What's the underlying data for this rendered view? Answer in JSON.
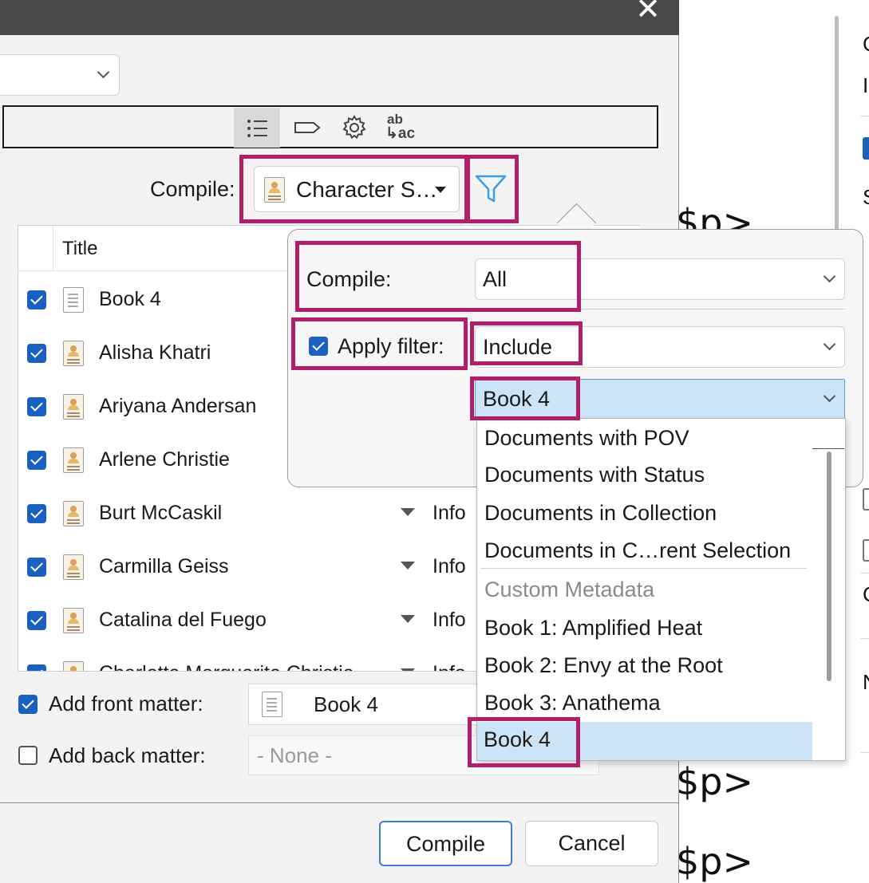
{
  "background": {
    "code_fragments": [
      "$p>",
      "$p>",
      "$p>"
    ],
    "side_letters": [
      "C",
      "I",
      "S",
      "C",
      "N"
    ]
  },
  "dialog": {
    "close_glyph": "✕",
    "toolbar": {
      "tabs": [
        {
          "icon": "list-icon",
          "active": true
        },
        {
          "icon": "tag-icon"
        },
        {
          "icon": "gear-icon"
        },
        {
          "icon": "replacements-icon",
          "label_top": "ab",
          "label_bottom": "↳ac"
        }
      ]
    },
    "compile": {
      "label": "Compile:",
      "selected": "Character S…"
    },
    "list": {
      "title_header": "Title",
      "rows": [
        {
          "title": "Book 4",
          "checked": true,
          "icon": "document-icon",
          "info": ""
        },
        {
          "title": "Alisha Khatri",
          "checked": true,
          "icon": "character-icon",
          "info": ""
        },
        {
          "title": "Ariyana Andersan",
          "checked": true,
          "icon": "character-icon",
          "info": ""
        },
        {
          "title": "Arlene Christie",
          "checked": true,
          "icon": "character-icon",
          "info": ""
        },
        {
          "title": "Burt McCaskil",
          "checked": true,
          "icon": "character-icon",
          "info": "Info"
        },
        {
          "title": "Carmilla Geiss",
          "checked": true,
          "icon": "character-icon",
          "info": "Info"
        },
        {
          "title": "Catalina del Fuego",
          "checked": true,
          "icon": "character-icon",
          "info": "Info"
        },
        {
          "title": "Charlotte Marguerite Christie",
          "checked": true,
          "icon": "character-icon",
          "info": "Info"
        }
      ]
    },
    "front_matter": {
      "label": "Add front matter:",
      "checked": true,
      "value": "Book 4"
    },
    "back_matter": {
      "label": "Add back matter:",
      "checked": false,
      "value": "- None -"
    },
    "buttons": {
      "compile": "Compile",
      "cancel": "Cancel"
    }
  },
  "filter_popover": {
    "compile_label": "Compile:",
    "compile_value": "All",
    "apply_filter_label": "Apply filter:",
    "apply_filter_checked": true,
    "mode_value": "Include",
    "target_value": "Book 4",
    "options": [
      "Documents with POV",
      "Documents with Status",
      "Documents in Collection",
      "Documents in C…rent Selection",
      "Custom Metadata",
      "Book 1: Amplified Heat",
      "Book 2: Envy at the Root",
      "Book 3: Anathema",
      "Book 4"
    ],
    "selected_option": "Book 4"
  },
  "colors": {
    "highlight": "#b01f6a",
    "selection": "#cce4f7",
    "checkbox": "#1a60c0",
    "filter_icon": "#3aa0e8",
    "titlebar": "#484848"
  }
}
